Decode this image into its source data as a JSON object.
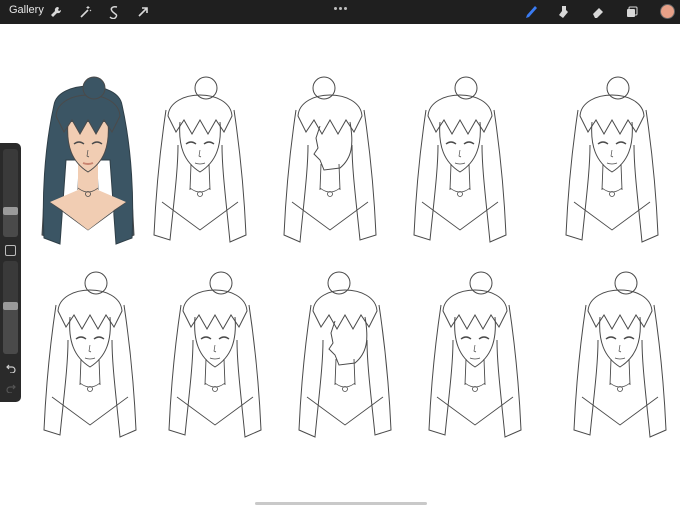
{
  "toolbar": {
    "gallery_label": "Gallery",
    "left_tools": [
      "wrench-icon",
      "magic-wand-icon",
      "selection-icon",
      "transform-arrow-icon"
    ],
    "right_tools": [
      "brush-icon",
      "smudge-icon",
      "eraser-icon",
      "layers-icon"
    ],
    "active_tool": "brush-icon",
    "accent_color": "#3a7bf2",
    "current_color": "#e8a188"
  },
  "sidebar": {
    "brush_size_level": 0.3,
    "opacity_level": 0.52,
    "icons": [
      "modify-square-icon",
      "undo-icon",
      "redo-icon"
    ]
  },
  "canvas": {
    "background": "#ffffff",
    "sketch_colors": {
      "line": "#4a4a4a",
      "hair_fill": "#3b5564",
      "skin_fill": "#f1cdb3",
      "lips": "#c98470"
    },
    "sketch_count": 10
  }
}
